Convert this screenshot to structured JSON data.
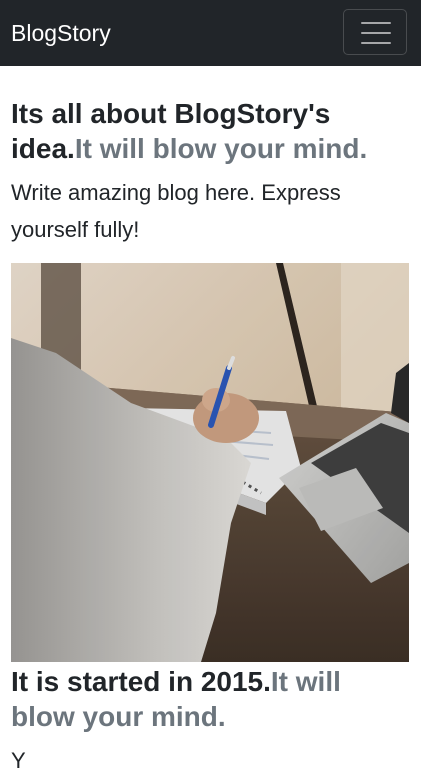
{
  "navbar": {
    "brand": "BlogStory",
    "toggler_icon": "hamburger-menu-icon"
  },
  "section1": {
    "title_main": "Its all about BlogStory's idea.",
    "title_muted": "It will blow your mind.",
    "lead": "Write amazing blog here. Express yourself fully!"
  },
  "hero_image": {
    "subject": "person writing in notebook beside laptop"
  },
  "section2": {
    "title_main": "It is started in 2015.",
    "title_muted": "It will blow your mind.",
    "paragraph": "Y"
  },
  "colors": {
    "navbar_bg": "#212529",
    "muted_text": "#6c757d",
    "body_text": "#212529"
  }
}
